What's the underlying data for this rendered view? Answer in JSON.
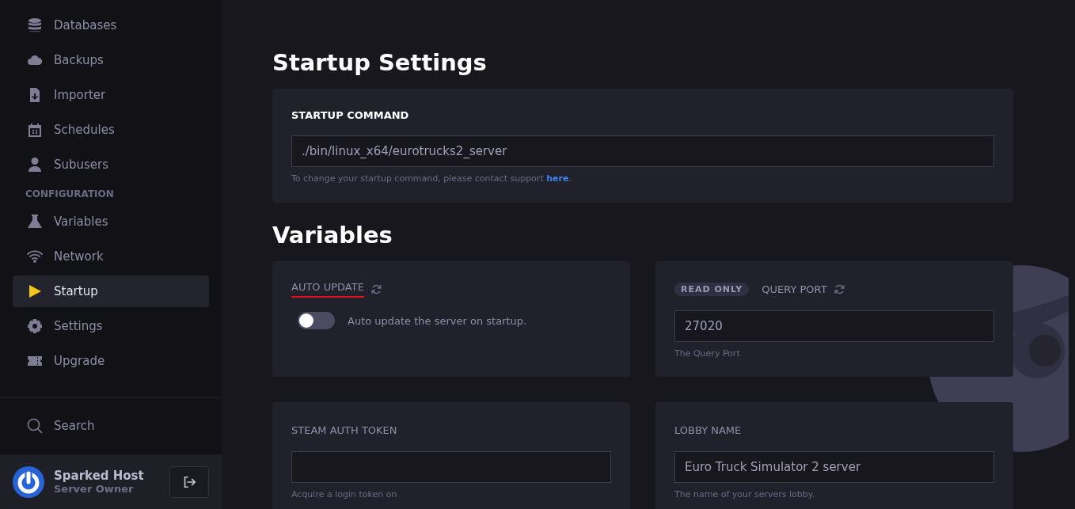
{
  "sidebar": {
    "items": [
      {
        "label": "Databases",
        "selected": false
      },
      {
        "label": "Backups",
        "selected": false
      },
      {
        "label": "Importer",
        "selected": false
      },
      {
        "label": "Schedules",
        "selected": false
      },
      {
        "label": "Subusers",
        "selected": false
      },
      {
        "kind": "section",
        "label": "CONFIGURATION"
      },
      {
        "label": "Variables",
        "selected": false
      },
      {
        "label": "Network",
        "selected": false
      },
      {
        "label": "Startup",
        "selected": true
      },
      {
        "label": "Settings",
        "selected": false
      },
      {
        "label": "Upgrade",
        "selected": false
      }
    ],
    "search": "Search",
    "user": {
      "name": "Sparked Host",
      "role": "Server Owner"
    }
  },
  "startup": {
    "title": "Startup Settings",
    "label": "STARTUP COMMAND",
    "command": "./bin/linux_x64/eurotrucks2_server",
    "help": "To change your startup command, please contact support",
    "link": "here",
    "after_link": "."
  },
  "variables": {
    "title": "Variables",
    "items": [
      {
        "kind": "toggle",
        "label": "AUTO UPDATE",
        "underlined": true,
        "refresh": true,
        "on": false,
        "toggle_label": "Auto update the server on startup."
      },
      {
        "kind": "field",
        "label": "QUERY PORT",
        "badge": "READ ONLY",
        "underlined": false,
        "refresh": true,
        "value": "27020",
        "help": "The Query Port"
      },
      {
        "kind": "field",
        "label": "STEAM AUTH TOKEN",
        "underlined": false,
        "refresh": false,
        "value": "",
        "help": "Acquire a login token on"
      },
      {
        "kind": "field",
        "label": "LOBBY NAME",
        "underlined": false,
        "refresh": false,
        "value": "Euro Truck Simulator 2 server",
        "help": "The name of your servers lobby."
      }
    ]
  }
}
